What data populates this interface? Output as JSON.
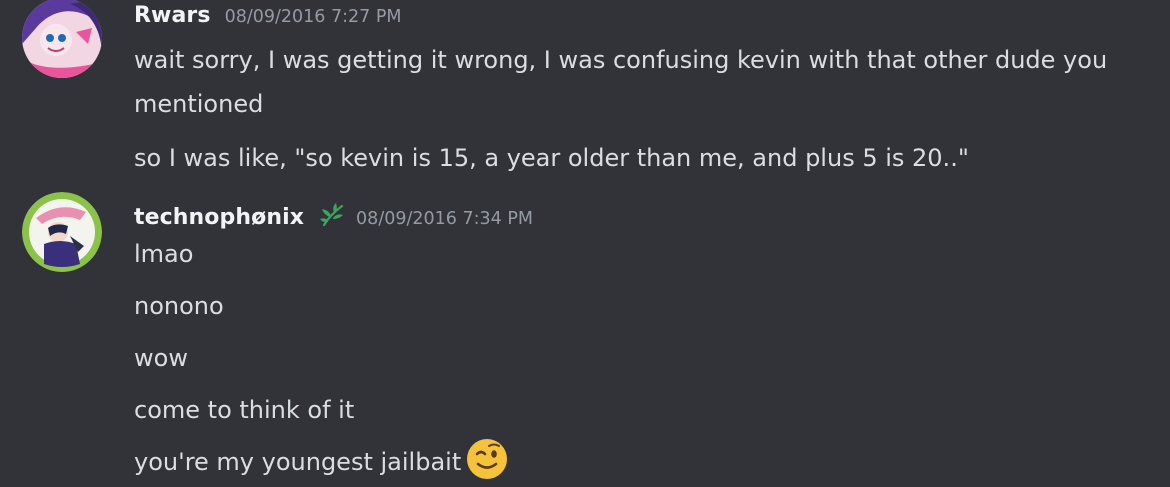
{
  "messages": [
    {
      "username": "Rwars",
      "timestamp": "08/09/2016 7:27 PM",
      "avatar": "rwars-avatar",
      "lines": [
        "wait sorry, I was getting it wrong, I was confusing kevin with that other dude you",
        "mentioned",
        "so I was like, \"so kevin is 15, a year older than me, and plus 5 is 20..\""
      ]
    },
    {
      "username": "technophønix",
      "timestamp": "08/09/2016 7:34 PM",
      "avatar": "technophonix-avatar",
      "role_icon": "leaf-icon",
      "lines": [
        "lmao",
        "nonono",
        "wow",
        "come to think of it",
        "you're my youngest jailbait"
      ],
      "emoji": "winking-face-emoji"
    }
  ],
  "colors": {
    "background": "#313338",
    "username": "#f2f3f5",
    "message_text": "#dbdee1",
    "timestamp": "#949ba4",
    "role_icon": "#3ba55c",
    "emoji": "#f5c33b"
  }
}
